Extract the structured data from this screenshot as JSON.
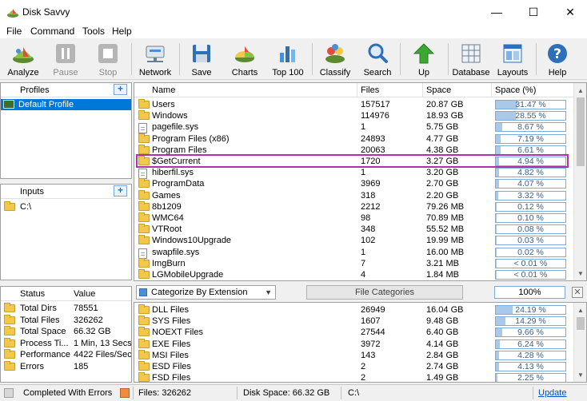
{
  "window": {
    "title": "Disk Savvy"
  },
  "menu": [
    "File",
    "Command",
    "Tools",
    "Help"
  ],
  "toolbar": {
    "analyze": "Analyze",
    "pause": "Pause",
    "stop": "Stop",
    "network": "Network",
    "save": "Save",
    "charts": "Charts",
    "top100": "Top 100",
    "classify": "Classify",
    "search": "Search",
    "up": "Up",
    "database": "Database",
    "layouts": "Layouts",
    "help": "Help"
  },
  "profiles": {
    "header": "Profiles",
    "items": [
      "Default Profile"
    ]
  },
  "inputs": {
    "header": "Inputs",
    "items": [
      "C:\\"
    ]
  },
  "stats": {
    "col_status": "Status",
    "col_value": "Value",
    "rows": [
      {
        "label": "Total Dirs",
        "value": "78551"
      },
      {
        "label": "Total Files",
        "value": "326262"
      },
      {
        "label": "Total Space",
        "value": "66.32 GB"
      },
      {
        "label": "Process Ti...",
        "value": "1 Min, 13 Secs"
      },
      {
        "label": "Performance",
        "value": "4422 Files/Sec"
      },
      {
        "label": "Errors",
        "value": "185"
      }
    ]
  },
  "main": {
    "columns": {
      "name": "Name",
      "files": "Files",
      "space": "Space",
      "space_pct": "Space (%)"
    },
    "rows": [
      {
        "name": "Users",
        "files": "157517",
        "space": "20.87 GB",
        "pct_text": "31.47 %",
        "pct": 31.47,
        "type": "folder"
      },
      {
        "name": "Windows",
        "files": "114976",
        "space": "18.93 GB",
        "pct_text": "28.55 %",
        "pct": 28.55,
        "type": "folder"
      },
      {
        "name": "pagefile.sys",
        "files": "1",
        "space": "5.75 GB",
        "pct_text": "8.67 %",
        "pct": 8.67,
        "type": "file"
      },
      {
        "name": "Program Files (x86)",
        "files": "24893",
        "space": "4.77 GB",
        "pct_text": "7.19 %",
        "pct": 7.19,
        "type": "folder"
      },
      {
        "name": "Program Files",
        "files": "20063",
        "space": "4.38 GB",
        "pct_text": "6.61 %",
        "pct": 6.61,
        "type": "folder"
      },
      {
        "name": "$GetCurrent",
        "files": "1720",
        "space": "3.27 GB",
        "pct_text": "4.94 %",
        "pct": 4.94,
        "type": "folder",
        "highlight": true
      },
      {
        "name": "hiberfil.sys",
        "files": "1",
        "space": "3.20 GB",
        "pct_text": "4.82 %",
        "pct": 4.82,
        "type": "file"
      },
      {
        "name": "ProgramData",
        "files": "3969",
        "space": "2.70 GB",
        "pct_text": "4.07 %",
        "pct": 4.07,
        "type": "folder"
      },
      {
        "name": "Games",
        "files": "318",
        "space": "2.20 GB",
        "pct_text": "3.32 %",
        "pct": 3.32,
        "type": "folder"
      },
      {
        "name": "8b1209",
        "files": "2212",
        "space": "79.26 MB",
        "pct_text": "0.12 %",
        "pct": 0.12,
        "type": "folder"
      },
      {
        "name": "WMC64",
        "files": "98",
        "space": "70.89 MB",
        "pct_text": "0.10 %",
        "pct": 0.1,
        "type": "folder"
      },
      {
        "name": "VTRoot",
        "files": "348",
        "space": "55.52 MB",
        "pct_text": "0.08 %",
        "pct": 0.08,
        "type": "folder"
      },
      {
        "name": "Windows10Upgrade",
        "files": "102",
        "space": "19.99 MB",
        "pct_text": "0.03 %",
        "pct": 0.03,
        "type": "folder"
      },
      {
        "name": "swapfile.sys",
        "files": "1",
        "space": "16.00 MB",
        "pct_text": "0.02 %",
        "pct": 0.02,
        "type": "file"
      },
      {
        "name": "ImgBurn",
        "files": "7",
        "space": "3.21 MB",
        "pct_text": "< 0.01 %",
        "pct": 0.01,
        "type": "folder"
      },
      {
        "name": "LGMobileUpgrade",
        "files": "4",
        "space": "1.84 MB",
        "pct_text": "< 0.01 %",
        "pct": 0.01,
        "type": "folder"
      }
    ]
  },
  "categorize": {
    "dropdown": "Categorize By Extension",
    "category_label": "File Categories",
    "percent": "100%",
    "rows": [
      {
        "name": "DLL Files",
        "files": "26949",
        "space": "16.04 GB",
        "pct_text": "24.19 %",
        "pct": 24.19
      },
      {
        "name": "SYS Files",
        "files": "1607",
        "space": "9.48 GB",
        "pct_text": "14.29 %",
        "pct": 14.29
      },
      {
        "name": "NOEXT Files",
        "files": "27544",
        "space": "6.40 GB",
        "pct_text": "9.66 %",
        "pct": 9.66
      },
      {
        "name": "EXE Files",
        "files": "3972",
        "space": "4.14 GB",
        "pct_text": "6.24 %",
        "pct": 6.24
      },
      {
        "name": "MSI Files",
        "files": "143",
        "space": "2.84 GB",
        "pct_text": "4.28 %",
        "pct": 4.28
      },
      {
        "name": "ESD Files",
        "files": "2",
        "space": "2.74 GB",
        "pct_text": "4.13 %",
        "pct": 4.13
      },
      {
        "name": "FSD Files",
        "files": "2",
        "space": "1.49 GB",
        "pct_text": "2.25 %",
        "pct": 2.25
      }
    ]
  },
  "statusbar": {
    "state": "Completed With Errors",
    "files": "Files: 326262",
    "space": "Disk Space: 66.32 GB",
    "path": "C:\\",
    "update": "Update"
  },
  "colors": {
    "accent": "#0078d7",
    "highlight_box": "#b030b0",
    "bar_fill": "#a9c9ea",
    "bar_border": "#7eaad6"
  }
}
